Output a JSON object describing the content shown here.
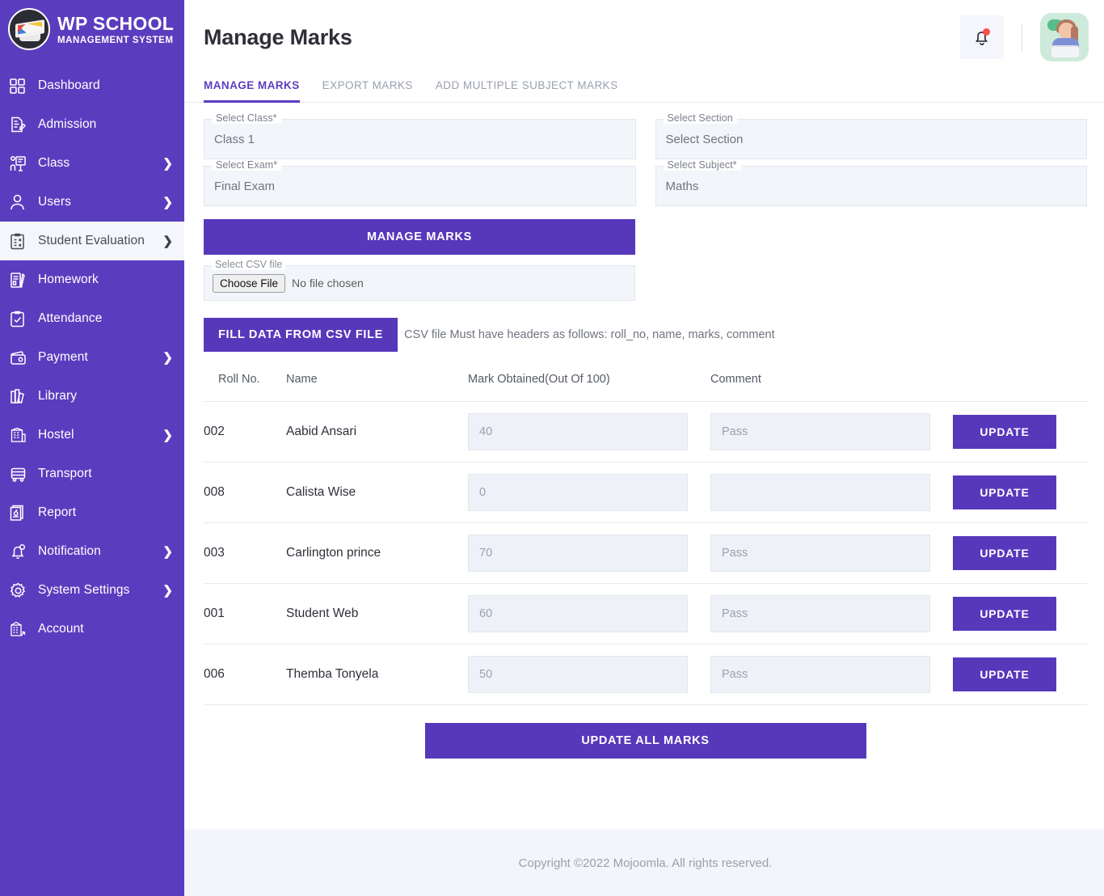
{
  "brand": {
    "title": "WP SCHOOL",
    "subtitle": "MANAGEMENT SYSTEM",
    "logo_icon": "graduation-cap-logo",
    "sidebar_color": "#5a3dbf"
  },
  "sidebar": {
    "items": [
      {
        "label": "Dashboard",
        "icon": "grid-icon",
        "chevron": false,
        "active": false
      },
      {
        "label": "Admission",
        "icon": "document-pen-icon",
        "chevron": false,
        "active": false
      },
      {
        "label": "Class",
        "icon": "classroom-icon",
        "chevron": true,
        "active": false
      },
      {
        "label": "Users",
        "icon": "user-icon",
        "chevron": true,
        "active": false
      },
      {
        "label": "Student Evaluation",
        "icon": "clipboard-check-icon",
        "chevron": true,
        "active": true
      },
      {
        "label": "Homework",
        "icon": "book-pen-icon",
        "chevron": false,
        "active": false
      },
      {
        "label": "Attendance",
        "icon": "clipboard-tick-icon",
        "chevron": false,
        "active": false
      },
      {
        "label": "Payment",
        "icon": "wallet-icon",
        "chevron": true,
        "active": false
      },
      {
        "label": "Library",
        "icon": "books-icon",
        "chevron": false,
        "active": false
      },
      {
        "label": "Hostel",
        "icon": "building-icon",
        "chevron": true,
        "active": false
      },
      {
        "label": "Transport",
        "icon": "bus-icon",
        "chevron": false,
        "active": false
      },
      {
        "label": "Report",
        "icon": "report-icon",
        "chevron": false,
        "active": false
      },
      {
        "label": "Notification",
        "icon": "bell-icon",
        "chevron": true,
        "active": false
      },
      {
        "label": "System Settings",
        "icon": "gear-icon",
        "chevron": true,
        "active": false
      },
      {
        "label": "Account",
        "icon": "bank-icon",
        "chevron": false,
        "active": false
      }
    ],
    "chevron_glyph": "❯"
  },
  "header": {
    "title": "Manage Marks",
    "bell_icon": "bell-icon",
    "notification_dot_color": "#ff4d4d",
    "avatar_icon": "support-agent-avatar"
  },
  "tabs": [
    {
      "label": "MANAGE MARKS",
      "active": true
    },
    {
      "label": "EXPORT MARKS",
      "active": false
    },
    {
      "label": "ADD MULTIPLE SUBJECT MARKS",
      "active": false
    }
  ],
  "form": {
    "select_class": {
      "legend": "Select Class*",
      "value": "Class 1"
    },
    "select_section": {
      "legend": "Select Section",
      "value": "Select Section"
    },
    "select_exam": {
      "legend": "Select Exam*",
      "value": "Final Exam"
    },
    "select_subject": {
      "legend": "Select Subject*",
      "value": "Maths"
    },
    "manage_marks_button": "MANAGE MARKS",
    "csv_file": {
      "legend": "Select CSV file",
      "choose_button": "Choose File",
      "no_file_text": "No file chosen"
    },
    "fill_button": "FILL DATA FROM CSV FILE",
    "csv_note": "CSV file Must have headers as follows: roll_no, name, marks, comment"
  },
  "table": {
    "headers": [
      "Roll No.",
      "Name",
      "Mark Obtained(Out Of 100)",
      "Comment",
      ""
    ],
    "rows": [
      {
        "roll": "002",
        "name": "Aabid Ansari",
        "mark": "40",
        "comment": "Pass",
        "action": "UPDATE"
      },
      {
        "roll": "008",
        "name": "Calista Wise",
        "mark": "0",
        "comment": "",
        "action": "UPDATE"
      },
      {
        "roll": "003",
        "name": "Carlington prince",
        "mark": "70",
        "comment": "Pass",
        "action": "UPDATE"
      },
      {
        "roll": "001",
        "name": "Student Web",
        "mark": "60",
        "comment": "Pass",
        "action": "UPDATE"
      },
      {
        "roll": "006",
        "name": "Themba Tonyela",
        "mark": "50",
        "comment": "Pass",
        "action": "UPDATE"
      }
    ],
    "update_all_button": "UPDATE ALL MARKS"
  },
  "footer": {
    "copyright": "Copyright ©2022 Mojoomla. All rights reserved."
  },
  "theme": {
    "accent": "#5738bb",
    "sidebar": "#5a3dbf",
    "input_bg": "#eef2f8",
    "footer_bg": "#f2f5fa"
  }
}
